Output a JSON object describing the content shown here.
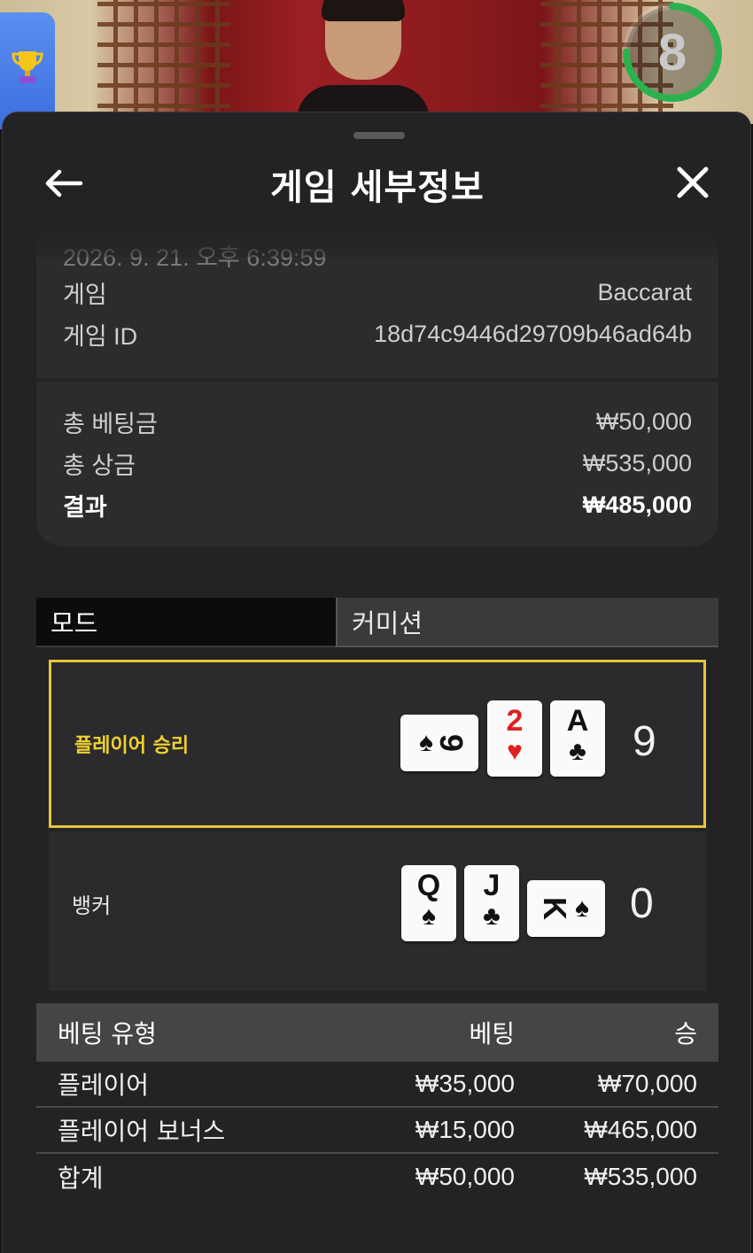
{
  "timer": {
    "value": "8",
    "progress": 0.75,
    "color": "#2bb24c"
  },
  "header": {
    "title": "게임 세부정보"
  },
  "details": {
    "datetime": "2026. 9. 21. 오후 6:39:59",
    "game_label": "게임",
    "game_value": "Baccarat",
    "game_id_label": "게임 ID",
    "game_id_value": "18d74c9446d29709b46ad64b"
  },
  "summary": {
    "total_bet_label": "총 베팅금",
    "total_bet_value": "₩50,000",
    "total_win_label": "총 상금",
    "total_win_value": "₩535,000",
    "result_label": "결과",
    "result_value": "₩485,000"
  },
  "tabs": [
    {
      "label": "모드",
      "active": true
    },
    {
      "label": "커미션",
      "active": false
    }
  ],
  "player": {
    "label": "플레이어 승리",
    "score": "9",
    "highlight_color": "#e6c53b",
    "cards": [
      {
        "rank": "9",
        "suit": "♠",
        "orientation": "sideways"
      },
      {
        "rank": "2",
        "suit": "♥",
        "orientation": "upright"
      },
      {
        "rank": "A",
        "suit": "♣",
        "orientation": "upright"
      }
    ]
  },
  "banker": {
    "label": "뱅커",
    "score": "0",
    "cards": [
      {
        "rank": "Q",
        "suit": "♠",
        "orientation": "upright"
      },
      {
        "rank": "J",
        "suit": "♣",
        "orientation": "upright"
      },
      {
        "rank": "K",
        "suit": "♠",
        "orientation": "sideways"
      }
    ]
  },
  "bets_table": {
    "headers": [
      "베팅 유형",
      "베팅",
      "승"
    ],
    "rows": [
      [
        "플레이어",
        "₩35,000",
        "₩70,000"
      ],
      [
        "플레이어 보너스",
        "₩15,000",
        "₩465,000"
      ],
      [
        "합계",
        "₩50,000",
        "₩535,000"
      ]
    ]
  },
  "icons": {
    "trophy": "trophy-icon",
    "back": "arrow-left-icon",
    "close": "close-icon"
  }
}
